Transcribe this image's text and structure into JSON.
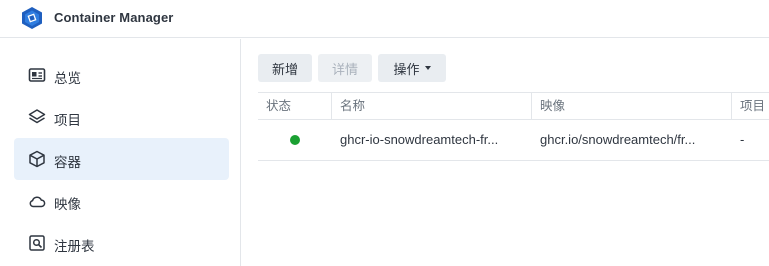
{
  "app": {
    "title": "Container Manager",
    "logo_icon": "container-manager-logo-icon"
  },
  "sidebar": {
    "items": [
      {
        "label": "总览",
        "icon": "overview-icon",
        "active": false
      },
      {
        "label": "项目",
        "icon": "layers-icon",
        "active": false
      },
      {
        "label": "容器",
        "icon": "cube-icon",
        "active": true
      },
      {
        "label": "映像",
        "icon": "cloud-icon",
        "active": false
      },
      {
        "label": "注册表",
        "icon": "registry-search-icon",
        "active": false
      }
    ]
  },
  "toolbar": {
    "new_label": "新增",
    "details_label": "详情",
    "actions_label": "操作"
  },
  "table": {
    "columns": [
      "状态",
      "名称",
      "映像",
      "项目"
    ],
    "rows": [
      {
        "status": "running",
        "name": "ghcr-io-snowdreamtech-fr...",
        "image": "ghcr.io/snowdreamtech/fr...",
        "project": "-"
      }
    ]
  },
  "colors": {
    "accent": "#1e6fd9",
    "active_bg": "#e8f1fb",
    "status_running": "#1aa032",
    "logo_blue": "#1f5fbf"
  }
}
